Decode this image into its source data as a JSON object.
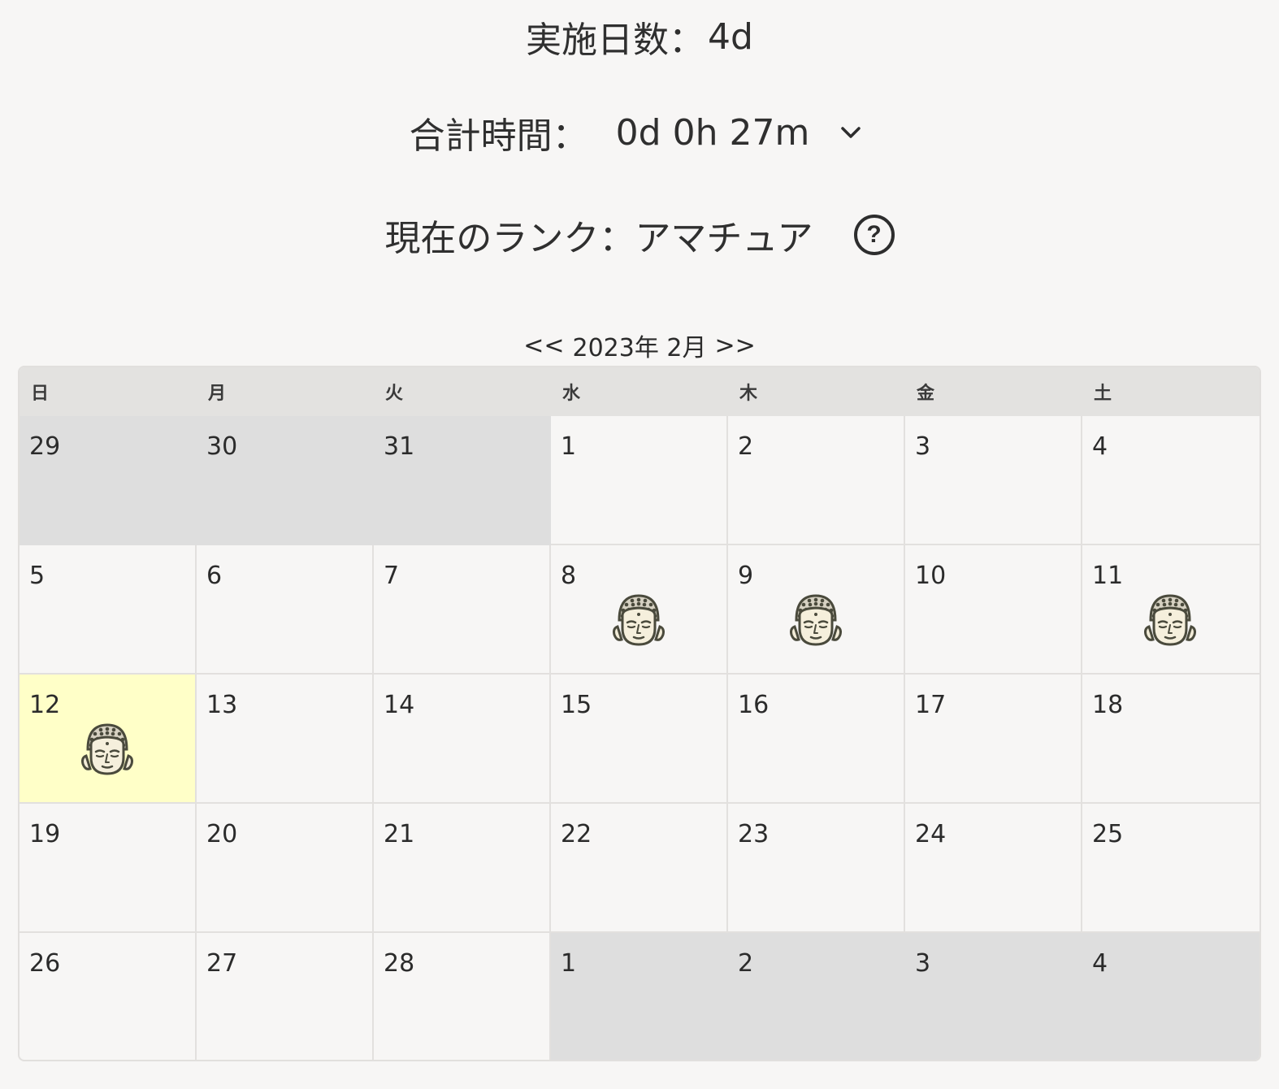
{
  "stats": {
    "days_label": "実施日数：",
    "days_value": "4d",
    "time_label": "合計時間：",
    "time_value": "0d 0h 27m",
    "rank_label": "現在のランク：",
    "rank_value": "アマチュア",
    "help_symbol": "?"
  },
  "calendar": {
    "prev_label": "<<",
    "month_label": "2023年 2月",
    "next_label": ">>",
    "weekdays": [
      "日",
      "月",
      "火",
      "水",
      "木",
      "金",
      "土"
    ],
    "days": [
      {
        "label": "29",
        "outside": true,
        "stamp": false
      },
      {
        "label": "30",
        "outside": true,
        "stamp": false
      },
      {
        "label": "31",
        "outside": true,
        "stamp": false
      },
      {
        "label": "1",
        "outside": false,
        "stamp": false
      },
      {
        "label": "2",
        "outside": false,
        "stamp": false
      },
      {
        "label": "3",
        "outside": false,
        "stamp": false
      },
      {
        "label": "4",
        "outside": false,
        "stamp": false
      },
      {
        "label": "5",
        "outside": false,
        "stamp": false
      },
      {
        "label": "6",
        "outside": false,
        "stamp": false
      },
      {
        "label": "7",
        "outside": false,
        "stamp": false
      },
      {
        "label": "8",
        "outside": false,
        "stamp": true
      },
      {
        "label": "9",
        "outside": false,
        "stamp": true
      },
      {
        "label": "10",
        "outside": false,
        "stamp": false
      },
      {
        "label": "11",
        "outside": false,
        "stamp": true
      },
      {
        "label": "12",
        "outside": false,
        "stamp": true,
        "today": true
      },
      {
        "label": "13",
        "outside": false,
        "stamp": false
      },
      {
        "label": "14",
        "outside": false,
        "stamp": false
      },
      {
        "label": "15",
        "outside": false,
        "stamp": false
      },
      {
        "label": "16",
        "outside": false,
        "stamp": false
      },
      {
        "label": "17",
        "outside": false,
        "stamp": false
      },
      {
        "label": "18",
        "outside": false,
        "stamp": false
      },
      {
        "label": "19",
        "outside": false,
        "stamp": false
      },
      {
        "label": "20",
        "outside": false,
        "stamp": false
      },
      {
        "label": "21",
        "outside": false,
        "stamp": false
      },
      {
        "label": "22",
        "outside": false,
        "stamp": false
      },
      {
        "label": "23",
        "outside": false,
        "stamp": false
      },
      {
        "label": "24",
        "outside": false,
        "stamp": false
      },
      {
        "label": "25",
        "outside": false,
        "stamp": false
      },
      {
        "label": "26",
        "outside": false,
        "stamp": false
      },
      {
        "label": "27",
        "outside": false,
        "stamp": false
      },
      {
        "label": "28",
        "outside": false,
        "stamp": false
      },
      {
        "label": "1",
        "outside": true,
        "stamp": false
      },
      {
        "label": "2",
        "outside": true,
        "stamp": false
      },
      {
        "label": "3",
        "outside": true,
        "stamp": false
      },
      {
        "label": "4",
        "outside": true,
        "stamp": false
      }
    ],
    "stamp_icon": "buddha-face-icon",
    "today_color": "#ffffc8",
    "outside_color": "#dedede"
  }
}
